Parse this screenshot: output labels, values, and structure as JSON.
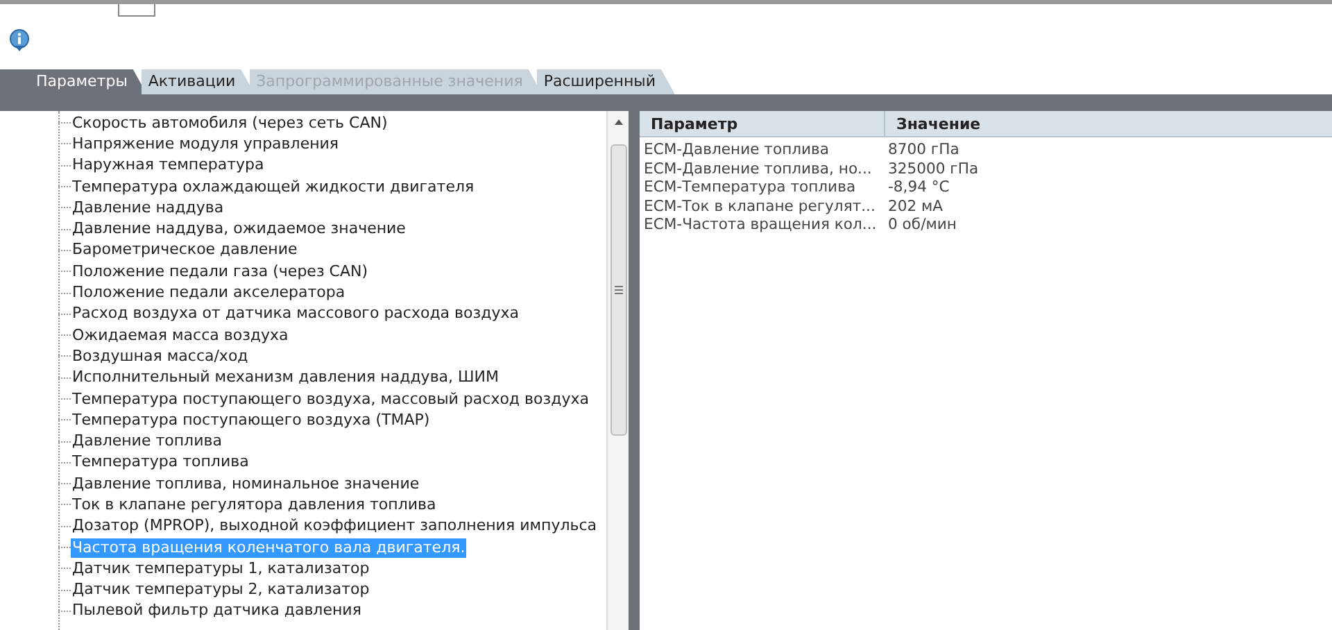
{
  "tabs": [
    {
      "label": "Параметры",
      "selected": true,
      "disabled": false
    },
    {
      "label": "Активации",
      "selected": false,
      "disabled": false
    },
    {
      "label": "Запрограммированные значения",
      "selected": false,
      "disabled": true
    },
    {
      "label": "Расширенный",
      "selected": false,
      "disabled": false
    }
  ],
  "parameter_list": [
    {
      "label": "Скорость автомобиля (через сеть CAN)",
      "selected": false
    },
    {
      "label": "Напряжение модуля управления",
      "selected": false
    },
    {
      "label": "Наружная температура",
      "selected": false
    },
    {
      "label": "Температура охлаждающей жидкости двигателя",
      "selected": false
    },
    {
      "label": "Давление наддува",
      "selected": false
    },
    {
      "label": "Давление наддува, ожидаемое значение",
      "selected": false
    },
    {
      "label": "Барометрическое давление",
      "selected": false
    },
    {
      "label": "Положение педали газа (через CAN)",
      "selected": false
    },
    {
      "label": "Положение педали акселератора",
      "selected": false
    },
    {
      "label": "Расход воздуха от датчика массового расхода воздуха",
      "selected": false
    },
    {
      "label": "Ожидаемая масса воздуха",
      "selected": false
    },
    {
      "label": "Воздушная масса/ход",
      "selected": false
    },
    {
      "label": "Исполнительный механизм давления наддува, ШИМ",
      "selected": false
    },
    {
      "label": "Температура поступающего воздуха, массовый расход воздуха",
      "selected": false
    },
    {
      "label": "Температура поступающего воздуха (TMAP)",
      "selected": false
    },
    {
      "label": "Давление топлива",
      "selected": false
    },
    {
      "label": "Температура топлива",
      "selected": false
    },
    {
      "label": "Давление топлива, номинальное значение",
      "selected": false
    },
    {
      "label": "Ток в клапане регулятора давления топлива",
      "selected": false
    },
    {
      "label": "Дозатор (MPROP), выходной коэффициент заполнения импульса",
      "selected": false
    },
    {
      "label": "Частота вращения коленчатого вала двигателя.",
      "selected": true
    },
    {
      "label": "Датчик температуры 1, катализатор",
      "selected": false
    },
    {
      "label": "Датчик температуры 2, катализатор",
      "selected": false
    },
    {
      "label": "Пылевой фильтр датчика давления",
      "selected": false
    }
  ],
  "table": {
    "columns": [
      "Параметр",
      "Значение"
    ],
    "rows": [
      [
        "ECM-Давление топлива",
        "8700 гПа"
      ],
      [
        "ECM-Давление топлива, но...",
        "325000 гПа"
      ],
      [
        "ECM-Температура топлива",
        "-8,94 °C"
      ],
      [
        "ECM-Ток в клапане регулят...",
        "202 мА"
      ],
      [
        "ECM-Частота вращения кол...",
        "0 об/мин"
      ]
    ]
  }
}
